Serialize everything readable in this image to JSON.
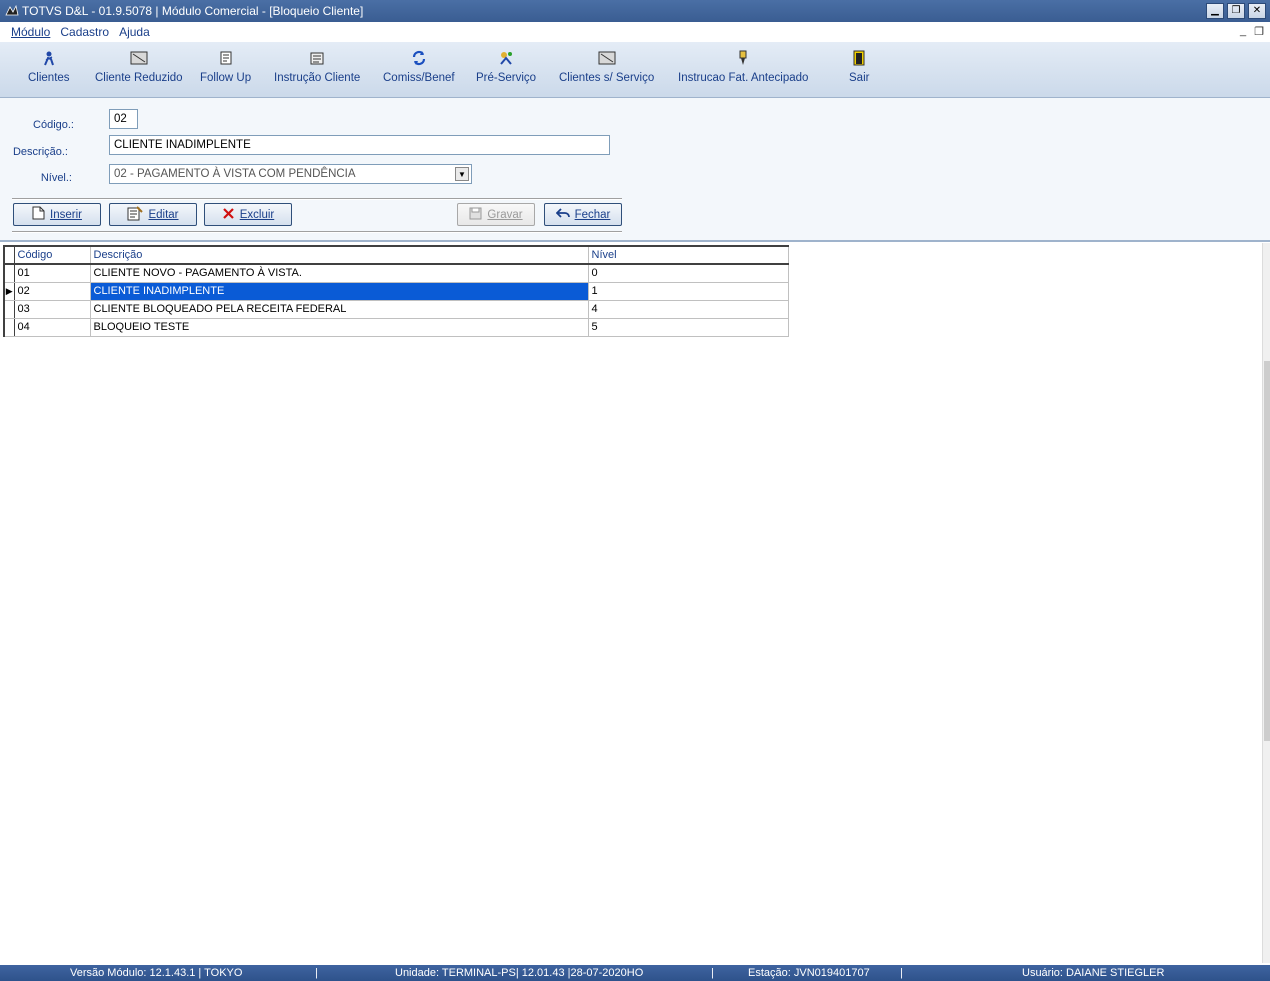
{
  "window": {
    "title": "TOTVS D&L - 01.9.5078 | Módulo Comercial - [Bloqueio Cliente]",
    "minimize_glyph": "▁",
    "restore_glyph": "❐",
    "close_glyph": "✕"
  },
  "menu": {
    "items": [
      "Módulo",
      "Cadastro",
      "Ajuda"
    ],
    "minimize_glyph": "_",
    "restore_glyph": "❐"
  },
  "toolbar": {
    "items": [
      {
        "label": "Clientes",
        "icon": "clients-icon"
      },
      {
        "label": "Cliente Reduzido",
        "icon": "reduced-client-icon"
      },
      {
        "label": "Follow Up",
        "icon": "follow-up-icon"
      },
      {
        "label": "Instrução Cliente",
        "icon": "client-instruction-icon"
      },
      {
        "label": "Comiss/Benef",
        "icon": "refresh-icon"
      },
      {
        "label": "Pré-Serviço",
        "icon": "pre-service-icon"
      },
      {
        "label": "Clientes s/ Serviço",
        "icon": "clients-no-service-icon"
      },
      {
        "label": "Instrucao Fat. Antecipado",
        "icon": "pen-icon"
      },
      {
        "label": "Sair",
        "icon": "exit-door-icon"
      }
    ]
  },
  "form": {
    "codigo_label": "Código.:",
    "codigo_value": "02",
    "descricao_label": "Descrição.:",
    "descricao_value": "CLIENTE INADIMPLENTE",
    "nivel_label": "Nível.:",
    "nivel_value": "02 - PAGAMENTO À VISTA COM PENDÊNCIA",
    "select_arrow": "▼"
  },
  "buttons": {
    "inserir": "Inserir",
    "editar": "Editar",
    "excluir": "Excluir",
    "gravar": "Gravar",
    "fechar": "Fechar"
  },
  "grid": {
    "headers": {
      "codigo": "Código",
      "descricao": "Descrição",
      "nivel": "Nível"
    },
    "current_row_marker": "▶",
    "rows": [
      {
        "codigo": "01",
        "descricao": "CLIENTE NOVO - PAGAMENTO À VISTA.",
        "nivel": "0"
      },
      {
        "codigo": "02",
        "descricao": "CLIENTE INADIMPLENTE",
        "nivel": "1"
      },
      {
        "codigo": "03",
        "descricao": "CLIENTE BLOQUEADO PELA RECEITA FEDERAL",
        "nivel": "4"
      },
      {
        "codigo": "04",
        "descricao": "BLOQUEIO TESTE",
        "nivel": "5"
      }
    ]
  },
  "status": {
    "versao": "Versão Módulo:  12.1.43.1  |  TOKYO",
    "sep1": "|",
    "unidade": "Unidade: TERMINAL-PS| 12.01.43 |28-07-2020HO",
    "sep2": "|",
    "estacao": "Estação: JVN019401707",
    "sep3": "|",
    "usuario": "Usuário: DAIANE STIEGLER"
  },
  "colors": {
    "accent": "#1a3f8a",
    "titlebar": "#3a5d92",
    "selection": "#0a5bd6",
    "statusbar": "#2e528b"
  }
}
